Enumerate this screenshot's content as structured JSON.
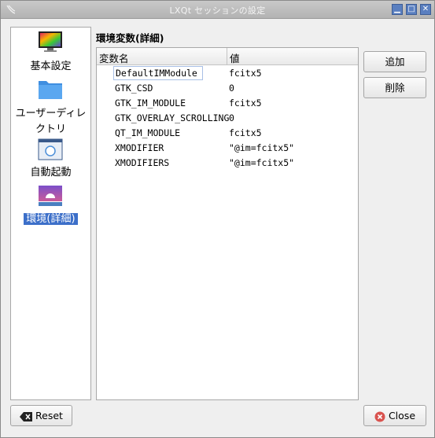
{
  "window": {
    "title": "LXQt セッションの設定"
  },
  "sidebar": {
    "items": [
      {
        "label": "基本設定",
        "icon": "monitor-colors-icon",
        "selected": false
      },
      {
        "label": "ユーザーディレクトリ",
        "label_line1": "ユーザーディレ",
        "label_line2": "クトリ",
        "icon": "folder-icon",
        "selected": false
      },
      {
        "label": "自動起動",
        "icon": "window-app-icon",
        "selected": false
      },
      {
        "label": "環境(詳細)",
        "icon": "desktop-environment-icon",
        "selected": true
      }
    ]
  },
  "main": {
    "section_title": "環境変数(詳細)",
    "columns": [
      "変数名",
      "値"
    ],
    "rows": [
      {
        "name": "DefaultIMModule",
        "value": "fcitx5"
      },
      {
        "name": "GTK_CSD",
        "value": "0"
      },
      {
        "name": "GTK_IM_MODULE",
        "value": "fcitx5"
      },
      {
        "name": "GTK_OVERLAY_SCROLLING",
        "value": "0"
      },
      {
        "name": "QT_IM_MODULE",
        "value": "fcitx5"
      },
      {
        "name": "XMODIFIER",
        "value": "\"@im=fcitx5\""
      },
      {
        "name": "XMODIFIERS",
        "value": "\"@im=fcitx5\""
      }
    ]
  },
  "buttons": {
    "add": "追加",
    "delete": "削除",
    "reset": "Reset",
    "close": "Close"
  },
  "colors": {
    "selection": "#3c6fc9",
    "title_button": "#5a7fc0",
    "close_icon": "#d9534f"
  }
}
